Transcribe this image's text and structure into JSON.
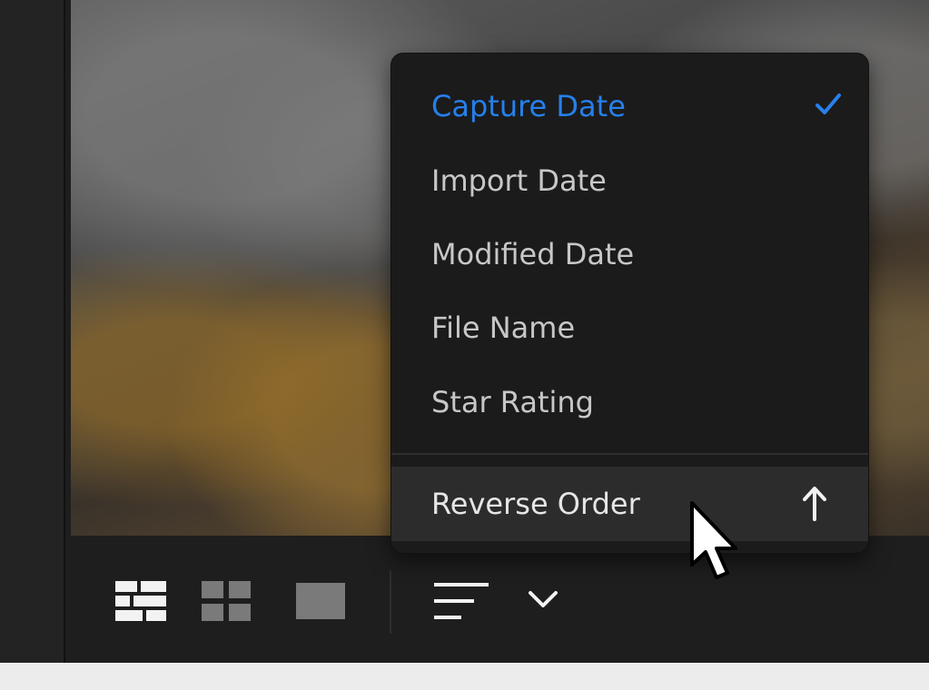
{
  "sort_menu": {
    "items": [
      {
        "label": "Capture Date",
        "selected": true
      },
      {
        "label": "Import Date",
        "selected": false
      },
      {
        "label": "Modified Date",
        "selected": false
      },
      {
        "label": "File Name",
        "selected": false
      },
      {
        "label": "Star Rating",
        "selected": false
      }
    ],
    "selected_icon": "checkmark-icon",
    "reverse_label": "Reverse Order",
    "reverse_icon": "arrow-up-icon"
  },
  "toolbar": {
    "view_modes": [
      "mosaic-view-icon",
      "square-grid-view-icon",
      "single-view-icon"
    ],
    "sort_icon": "sort-lines-icon",
    "dropdown_icon": "chevron-down-icon"
  },
  "colors": {
    "accent": "#2680eb",
    "menu_bg": "#1b1b1b",
    "hover_bg": "#2c2c2c",
    "text": "#c7c7c7"
  }
}
